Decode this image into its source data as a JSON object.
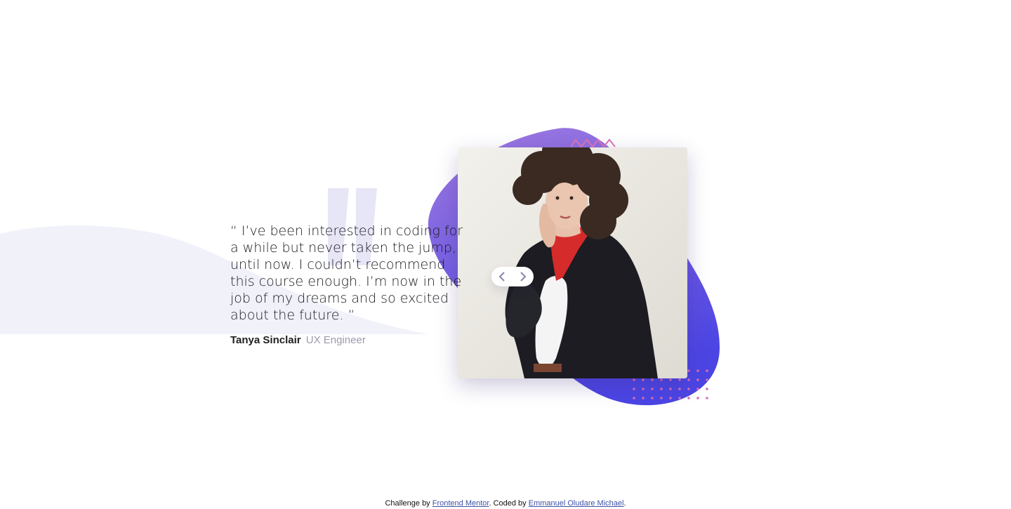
{
  "testimonial": {
    "quote": "“ I’ve been interested in coding for a while but never taken the jump, until now. I couldn’t recommend this course enough. I’m now in the job of my dreams and so excited about the future. ”",
    "name": "Tanya Sinclair",
    "role": "UX Engineer"
  },
  "navigation": {
    "prev_icon": "chevron-left-icon",
    "next_icon": "chevron-right-icon"
  },
  "footer": {
    "prefix": "Challenge by",
    "frontend_link": "Frontend Mentor",
    "middle": ". Coded by",
    "author_link": "Emmanuel Oludare Michael",
    "suffix": "."
  },
  "colors": {
    "background": "#ffffff",
    "curve": "#f1f1fa",
    "quote_mark": "#e7e6f7",
    "blob_start": "#8a5ed8",
    "blob_end": "#4d46e5",
    "pattern_pink": "#d86fb2",
    "text_dark": "#202023",
    "text_muted": "#9a9ab0"
  }
}
